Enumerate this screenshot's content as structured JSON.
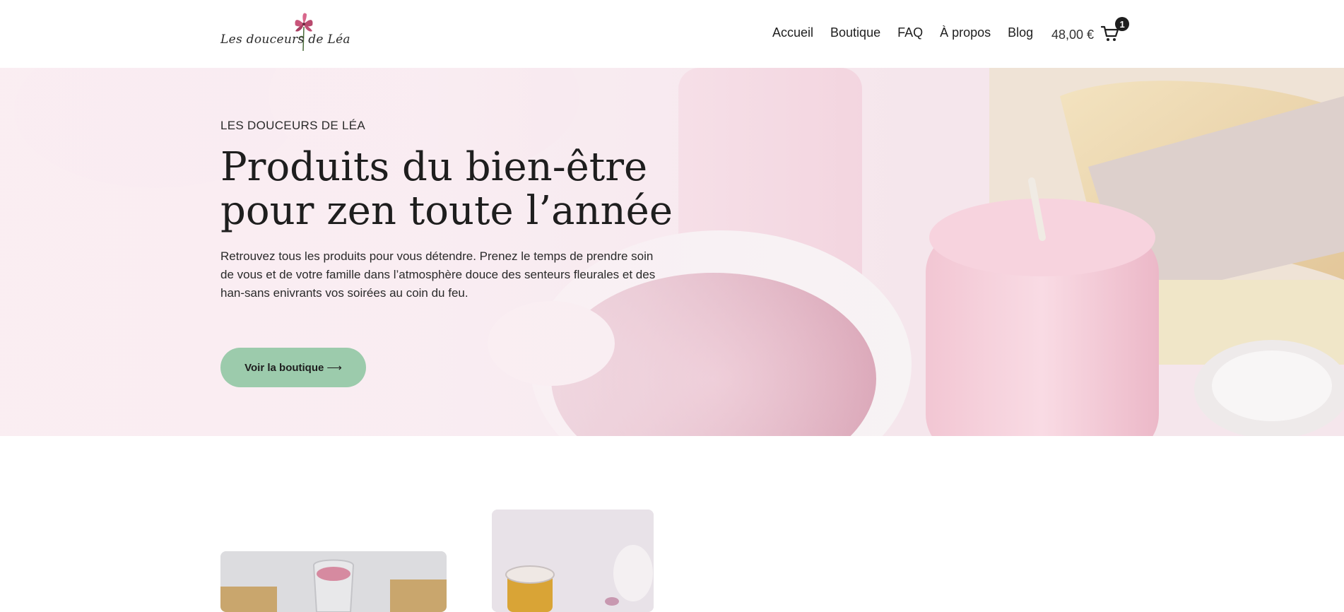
{
  "header": {
    "logo_text": "Les douceurs de Léa",
    "nav": [
      {
        "label": "Accueil"
      },
      {
        "label": "Boutique"
      },
      {
        "label": "FAQ"
      },
      {
        "label": "À propos"
      },
      {
        "label": "Blog"
      }
    ],
    "cart": {
      "total": "48,00 €",
      "count": "1",
      "icon": "cart-icon"
    }
  },
  "hero": {
    "eyebrow": "LES DOUCEURS DE LÉA",
    "title": "Produits du bien-être pour zen toute l’année",
    "text": "Retrouvez tous les produits pour vous détendre. Prenez le temps de prendre soin de vous et de votre famille dans l’atmosphère douce des senteurs fleurales et des han-sans enivrants vos soirées au coin du feu.",
    "button_label": "Voir la boutique",
    "button_icon": "arrow-right-icon"
  },
  "colors": {
    "accent": "#9ccbac",
    "hero_bg": "#f6e8ee",
    "text": "#1e1e1e"
  }
}
